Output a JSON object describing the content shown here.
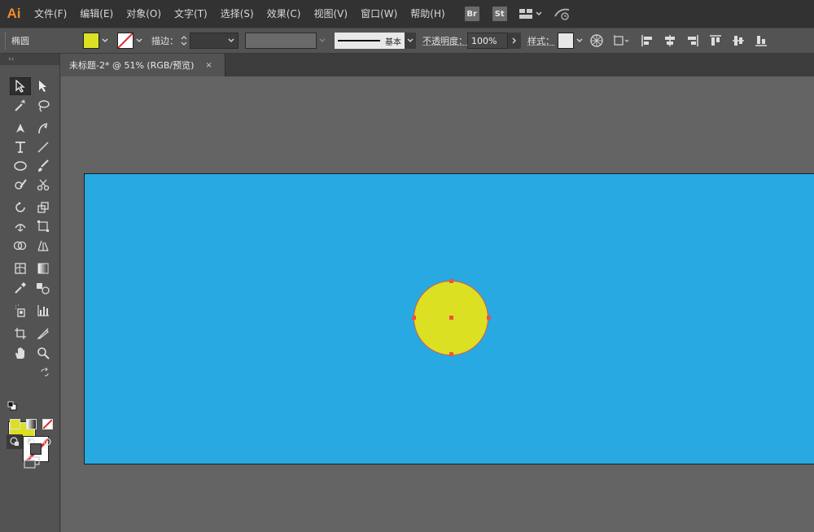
{
  "app": {
    "logo": "Ai"
  },
  "menu": [
    "文件(F)",
    "编辑(E)",
    "对象(O)",
    "文字(T)",
    "选择(S)",
    "效果(C)",
    "视图(V)",
    "窗口(W)",
    "帮助(H)"
  ],
  "menu_badges": {
    "bridge": "Br",
    "stock": "St"
  },
  "control": {
    "selection_label": "椭圆",
    "fill_color": "#dbe023",
    "stroke_label": "描边：",
    "stroke_profile": "基本",
    "opacity_label": "不透明度：",
    "opacity_value": "100%",
    "style_label": "样式："
  },
  "document_tab": {
    "title": "未标题-2* @ 51% (RGB/预览)",
    "close": "×"
  },
  "toolbox": {
    "collapse": "‹‹"
  },
  "canvas": {
    "artboard_color": "#28a9e1",
    "shape_fill": "#dbe023",
    "selection_color": "#e8553e"
  }
}
